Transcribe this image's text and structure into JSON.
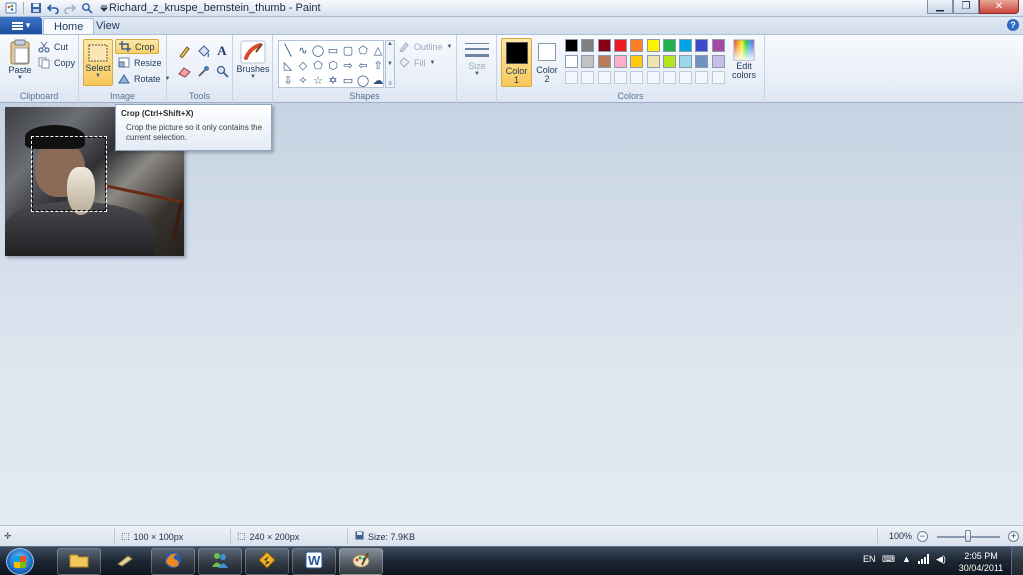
{
  "window": {
    "title": "Richard_z_kruspe_bernstein_thumb - Paint",
    "minimize_icon": "minimize-icon",
    "maximize_icon": "maximize-icon",
    "close_icon": "close-icon"
  },
  "tabs": [
    {
      "label": "Home",
      "active": true
    },
    {
      "label": "View",
      "active": false
    }
  ],
  "ribbon": {
    "clipboard": {
      "group_label": "Clipboard",
      "paste": "Paste",
      "cut": "Cut",
      "copy": "Copy"
    },
    "image": {
      "group_label": "Image",
      "select": "Select",
      "crop": "Crop",
      "resize": "Resize",
      "rotate": "Rotate"
    },
    "tools": {
      "group_label": "Tools"
    },
    "brushes": {
      "label": "Brushes"
    },
    "shapes": {
      "group_label": "Shapes",
      "outline": "Outline",
      "fill": "Fill"
    },
    "size": {
      "label": "Size"
    },
    "colors": {
      "group_label": "Colors",
      "color1": "Color 1",
      "color1_line1": "Color",
      "color1_line2": "1",
      "color2_line1": "Color",
      "color2_line2": "2",
      "edit_line1": "Edit",
      "edit_line2": "colors",
      "color1_value": "#000000",
      "color2_value": "#ffffff",
      "palette_row1": [
        "#000000",
        "#7f7f7f",
        "#880015",
        "#ed1c24",
        "#ff7f27",
        "#fff200",
        "#22b14c",
        "#00a2e8",
        "#3f48cc",
        "#a349a4"
      ],
      "palette_row2": [
        "#ffffff",
        "#c3c3c3",
        "#b97a57",
        "#ffaec9",
        "#ffc90e",
        "#efe4b0",
        "#b5e61d",
        "#99d9ea",
        "#7092be",
        "#c8bfe7"
      ]
    }
  },
  "tooltip": {
    "title": "Crop (Ctrl+Shift+X)",
    "description": "Crop the picture so it only contains the current selection."
  },
  "statusbar": {
    "selection_size": "100 × 100px",
    "image_size": "240 × 200px",
    "file_size": "Size: 7.9KB",
    "zoom": "100%"
  },
  "taskbar": {
    "language": "EN",
    "time": "2:05 PM",
    "date": "30/04/2011"
  }
}
